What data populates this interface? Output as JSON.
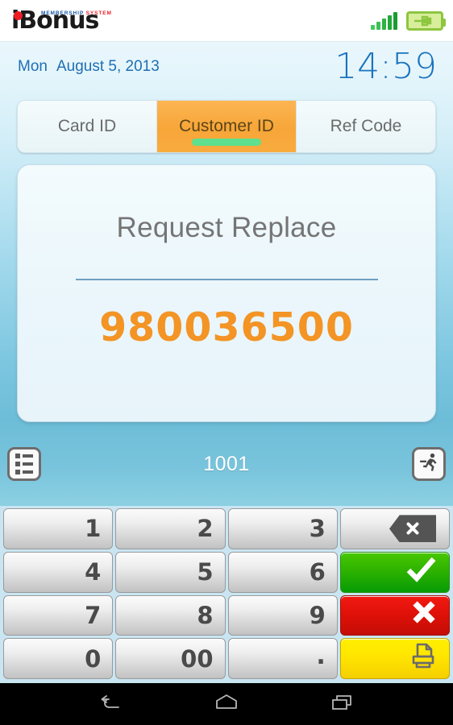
{
  "titlebar": {
    "logo_text": "iBonus",
    "logo_tagline_part1": "MEMBERSHIP",
    "logo_tagline_part2": "SYSTEM",
    "signal_icon": "signal-bars-icon",
    "battery_icon": "battery-charging-icon"
  },
  "header": {
    "day_of_week": "Mon",
    "date": "August 5, 2013",
    "time": "14:59"
  },
  "tabs": [
    {
      "label": "Card ID",
      "active": false
    },
    {
      "label": "Customer ID",
      "active": true
    },
    {
      "label": "Ref Code",
      "active": false
    }
  ],
  "card": {
    "title": "Request Replace",
    "value": "980036500"
  },
  "statusbar": {
    "list_icon": "list-icon",
    "value": "1001",
    "exit_icon": "running-man-icon"
  },
  "keypad": {
    "rows": [
      [
        {
          "label": "1",
          "type": "digit",
          "name": "key-1"
        },
        {
          "label": "2",
          "type": "digit",
          "name": "key-2"
        },
        {
          "label": "3",
          "type": "digit",
          "name": "key-3"
        },
        {
          "label": "",
          "type": "backspace",
          "name": "key-backspace"
        }
      ],
      [
        {
          "label": "4",
          "type": "digit",
          "name": "key-4"
        },
        {
          "label": "5",
          "type": "digit",
          "name": "key-5"
        },
        {
          "label": "6",
          "type": "digit",
          "name": "key-6"
        },
        {
          "label": "",
          "type": "confirm",
          "name": "key-confirm"
        }
      ],
      [
        {
          "label": "7",
          "type": "digit",
          "name": "key-7"
        },
        {
          "label": "8",
          "type": "digit",
          "name": "key-8"
        },
        {
          "label": "9",
          "type": "digit",
          "name": "key-9"
        },
        {
          "label": "",
          "type": "cancel",
          "name": "key-cancel"
        }
      ],
      [
        {
          "label": "0",
          "type": "digit",
          "name": "key-0"
        },
        {
          "label": "00",
          "type": "digit",
          "name": "key-00"
        },
        {
          "label": ".",
          "type": "dot",
          "name": "key-dot"
        },
        {
          "label": "",
          "type": "print",
          "name": "key-print"
        }
      ]
    ]
  },
  "navbar": {
    "back_icon": "back-arrow-icon",
    "home_icon": "home-icon",
    "recents_icon": "recent-apps-icon"
  },
  "colors": {
    "accent_orange": "#f39425",
    "tab_active": "#f7a638",
    "tab_indicator_green": "#5ee08e",
    "confirm_green": "#2eb300",
    "cancel_red": "#e01109",
    "print_yellow": "#ffe500",
    "header_blue": "#1a74be",
    "keypad_bg": "#c9e5f2"
  }
}
